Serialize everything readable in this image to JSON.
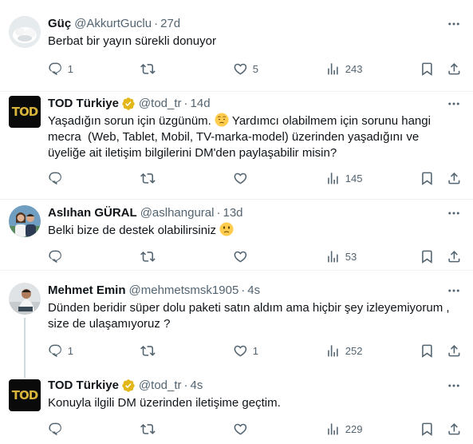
{
  "tweets": [
    {
      "name": "Güç",
      "handle": "@AkkurtGuclu",
      "time": "27d",
      "text": "Berbat bir yayın sürekli donuyor",
      "replies": "1",
      "retweets": "",
      "likes": "5",
      "views": "243",
      "verified": false
    },
    {
      "name": "TOD Türkiye",
      "handle": "@tod_tr",
      "time": "14d",
      "text_lines": [
        "Yaşadığın sorun için üzgünüm.",
        "Yardımcı olabilmem için sorunu hangi",
        "mecra  (Web, Tablet, Mobil, TV-marka-model) üzerinden yaşadığını ve",
        "üyeliğe ait iletişim bilgilerini DM'den paylaşabilir misin?"
      ],
      "replies": "",
      "retweets": "",
      "likes": "",
      "views": "145",
      "verified": true
    },
    {
      "name": "Aslıhan GÜRAL",
      "handle": "@aslhangural",
      "time": "13d",
      "text": "Belki bize de destek olabilirsiniz",
      "replies": "",
      "retweets": "",
      "likes": "",
      "views": "53",
      "verified": false
    },
    {
      "name": "Mehmet Emin",
      "handle": "@mehmetsmsk1905",
      "time": "4s",
      "text_lines": [
        "Dünden beridir süper dolu paketi satın aldım ama hiçbir şey izleyemiyorum ,",
        "size de ulaşamıyoruz ?"
      ],
      "replies": "1",
      "retweets": "",
      "likes": "1",
      "views": "252",
      "verified": false
    },
    {
      "name": "TOD Türkiye",
      "handle": "@tod_tr",
      "time": "4s",
      "text": "Konuyla ilgili DM üzerinden iletişime geçtim.",
      "replies": "",
      "retweets": "",
      "likes": "",
      "views": "229",
      "verified": true
    }
  ],
  "logo_text": "TOD",
  "colors": {
    "text": "#0f1419",
    "secondary": "#536471",
    "verified_gold": "#e2b719",
    "separator": "#eff3f4",
    "thread_line": "#cfd9de",
    "tod_background": "#0a0a0a",
    "tod_logo_gold": "#d9b43a"
  },
  "icons": [
    "more-icon",
    "reply-icon",
    "retweet-icon",
    "like-icon",
    "views-icon",
    "bookmark-icon",
    "share-icon",
    "verified-badge-icon",
    "worried-face-emoji",
    "confused-face-emoji"
  ]
}
